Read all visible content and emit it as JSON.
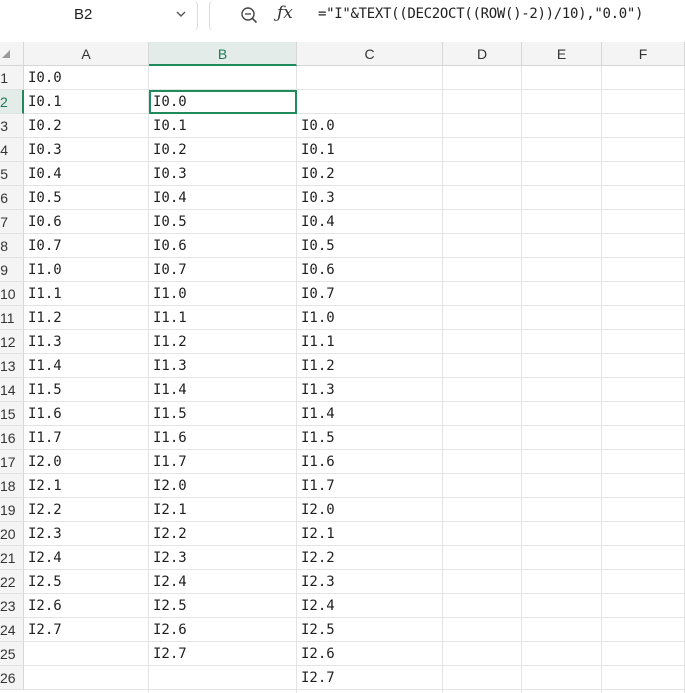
{
  "formula_bar": {
    "cell_ref": "B2",
    "formula": "=\"I\"&TEXT((DEC2OCT((ROW()-2))/10),\"0.0\")",
    "icons": [
      "chevron-down-icon",
      "zoom-icon",
      "fx-icon"
    ]
  },
  "columns": [
    "A",
    "B",
    "C",
    "D",
    "E",
    "F"
  ],
  "selected_column": "B",
  "selected_row": "2",
  "rows": [
    "1",
    "2",
    "3",
    "4",
    "5",
    "6",
    "7",
    "8",
    "9",
    "10",
    "11",
    "12",
    "13",
    "14",
    "15",
    "16",
    "17",
    "18",
    "19",
    "20",
    "21",
    "22",
    "23",
    "24",
    "25",
    "26"
  ],
  "col_a": [
    "I0.0",
    "I0.1",
    "I0.2",
    "I0.3",
    "I0.4",
    "I0.5",
    "I0.6",
    "I0.7",
    "I1.0",
    "I1.1",
    "I1.2",
    "I1.3",
    "I1.4",
    "I1.5",
    "I1.6",
    "I1.7",
    "I2.0",
    "I2.1",
    "I2.2",
    "I2.3",
    "I2.4",
    "I2.5",
    "I2.6",
    "I2.7"
  ],
  "col_b": [
    "",
    "I0.0",
    "I0.1",
    "I0.2",
    "I0.3",
    "I0.4",
    "I0.5",
    "I0.6",
    "I0.7",
    "I1.0",
    "I1.1",
    "I1.2",
    "I1.3",
    "I1.4",
    "I1.5",
    "I1.6",
    "I1.7",
    "I2.0",
    "I2.1",
    "I2.2",
    "I2.3",
    "I2.4",
    "I2.5",
    "I2.6",
    "I2.7"
  ],
  "col_c": [
    "",
    "",
    "I0.0",
    "I0.1",
    "I0.2",
    "I0.3",
    "I0.4",
    "I0.5",
    "I0.6",
    "I0.7",
    "I1.0",
    "I1.1",
    "I1.2",
    "I1.3",
    "I1.4",
    "I1.5",
    "I1.6",
    "I1.7",
    "I2.0",
    "I2.1",
    "I2.2",
    "I2.3",
    "I2.4",
    "I2.5",
    "I2.6",
    "I2.7"
  ]
}
